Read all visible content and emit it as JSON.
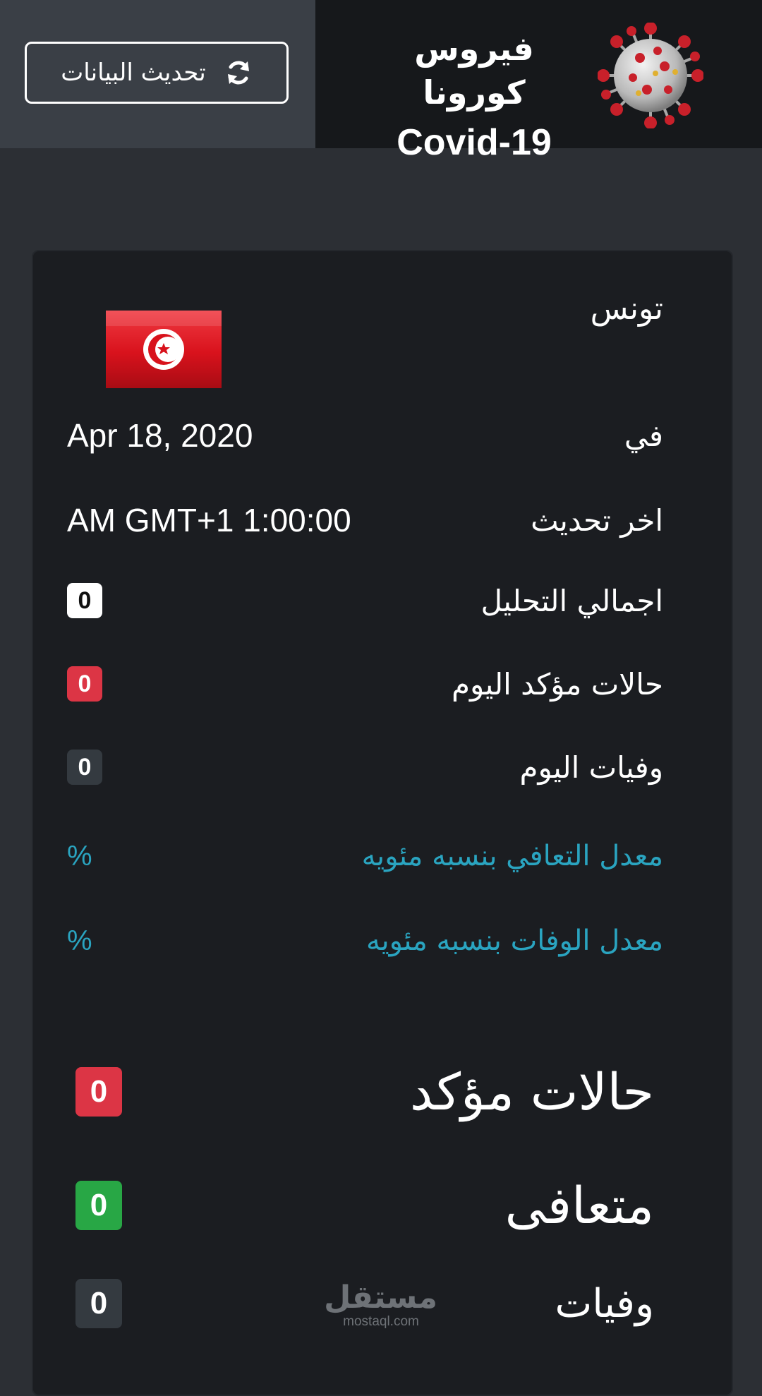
{
  "header": {
    "refresh_label": "تحديث البيانات",
    "refresh_icon": "sync-icon",
    "title_ar": "فيروس كورونا",
    "title_en": "Covid-19",
    "logo_icon": "coronavirus-icon"
  },
  "country": {
    "name": "تونس",
    "flag_icon": "tunisia-flag"
  },
  "details": {
    "date_label": "في",
    "date_value": "Apr 18, 2020",
    "updated_label": "اخر تحديث",
    "updated_value": "AM GMT+1 1:00:00",
    "tests_label": "اجمالي التحليل",
    "tests_value": "0",
    "today_cases_label": "حالات مؤكد اليوم",
    "today_cases_value": "0",
    "today_deaths_label": "وفيات اليوم",
    "today_deaths_value": "0",
    "recovery_rate_label": "معدل التعافي بنسبه مئويه",
    "recovery_rate_value": "%",
    "death_rate_label": "معدل الوفات بنسبه مئويه",
    "death_rate_value": "%"
  },
  "totals": {
    "confirmed_label": "حالات مؤكد",
    "confirmed_value": "0",
    "recovered_label": "متعافى",
    "recovered_value": "0",
    "deaths_label": "وفيات",
    "deaths_value": "0"
  },
  "watermark": {
    "ar": "مستقل",
    "en": "mostaql.com"
  },
  "colors": {
    "header_left_bg": "#3a3f46",
    "header_right_bg": "#16181b",
    "card_bg": "#1b1d21",
    "teal": "#2aa4c0",
    "danger": "#dc3545",
    "success": "#28a745",
    "dark_badge": "#343a40"
  }
}
